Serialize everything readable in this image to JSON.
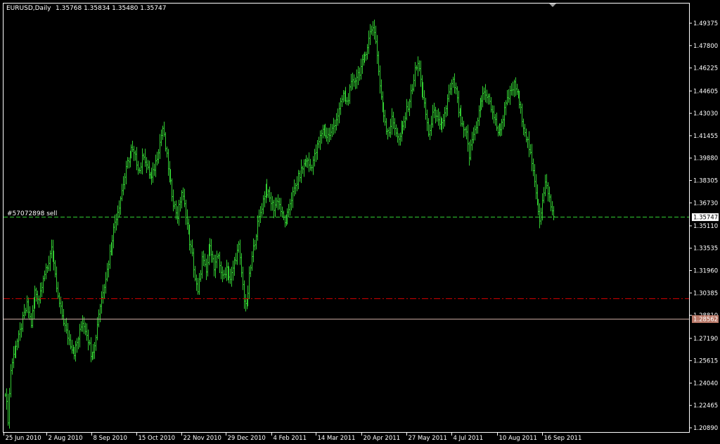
{
  "header": {
    "symbol_label": "EURUSD,Daily",
    "ohlc_values": "1.35768 1.35834 1.35480 1.35747"
  },
  "order_line": {
    "label": "#57072898 sell",
    "price": 1.3574
  },
  "current_price": {
    "text": "1.35747",
    "value": 1.35747
  },
  "level_line": {
    "text": "1.28562",
    "value": 1.28562
  },
  "stop_line": {
    "value": 1.3002
  },
  "colors": {
    "background": "#000000",
    "frame": "#ffffff",
    "bars": "#32cd32",
    "order_line": "#32cd32",
    "stop_line": "#cc0000",
    "level_line": "#c8a8a0",
    "level_tag": "#b87868"
  },
  "chart_data": {
    "type": "ohlc",
    "title": "EURUSD,Daily",
    "ylim": [
      1.2085,
      1.5054
    ],
    "price_ticks": [
      "1.49375",
      "1.47800",
      "1.46225",
      "1.44605",
      "1.43030",
      "1.41455",
      "1.39880",
      "1.38305",
      "1.36730",
      "1.35110",
      "1.33535",
      "1.31960",
      "1.30385",
      "1.28810",
      "1.27190",
      "1.25615",
      "1.24040",
      "1.22465",
      "1.20890"
    ],
    "date_ticks": [
      "25 Jun 2010",
      "2 Aug 2010",
      "8 Sep 2010",
      "15 Oct 2010",
      "22 Nov 2010",
      "29 Dec 2010",
      "4 Feb 2011",
      "14 Mar 2011",
      "20 Apr 2011",
      "27 May 2011",
      "4 Jul 2011",
      "10 Aug 2011",
      "16 Sep 2011"
    ],
    "anchors": [
      [
        0,
        1.235
      ],
      [
        2,
        1.215
      ],
      [
        4,
        1.25
      ],
      [
        7,
        1.265
      ],
      [
        10,
        1.272
      ],
      [
        13,
        1.285
      ],
      [
        16,
        1.295
      ],
      [
        19,
        1.282
      ],
      [
        22,
        1.305
      ],
      [
        25,
        1.3
      ],
      [
        28,
        1.316
      ],
      [
        31,
        1.32
      ],
      [
        34,
        1.338
      ],
      [
        36,
        1.322
      ],
      [
        39,
        1.3
      ],
      [
        42,
        1.288
      ],
      [
        45,
        1.276
      ],
      [
        48,
        1.268
      ],
      [
        51,
        1.262
      ],
      [
        54,
        1.272
      ],
      [
        57,
        1.284
      ],
      [
        60,
        1.276
      ],
      [
        63,
        1.262
      ],
      [
        66,
        1.266
      ],
      [
        69,
        1.29
      ],
      [
        72,
        1.306
      ],
      [
        75,
        1.32
      ],
      [
        78,
        1.338
      ],
      [
        81,
        1.354
      ],
      [
        84,
        1.366
      ],
      [
        87,
        1.381
      ],
      [
        90,
        1.395
      ],
      [
        93,
        1.405
      ],
      [
        96,
        1.399
      ],
      [
        99,
        1.39
      ],
      [
        102,
        1.402
      ],
      [
        105,
        1.39
      ],
      [
        108,
        1.384
      ],
      [
        111,
        1.396
      ],
      [
        114,
        1.41
      ],
      [
        116,
        1.42
      ],
      [
        118,
        1.406
      ],
      [
        121,
        1.386
      ],
      [
        124,
        1.368
      ],
      [
        127,
        1.358
      ],
      [
        130,
        1.375
      ],
      [
        133,
        1.36
      ],
      [
        135,
        1.345
      ],
      [
        138,
        1.33
      ],
      [
        140,
        1.314
      ],
      [
        142,
        1.303
      ],
      [
        145,
        1.328
      ],
      [
        148,
        1.318
      ],
      [
        151,
        1.34
      ],
      [
        154,
        1.32
      ],
      [
        157,
        1.33
      ],
      [
        160,
        1.314
      ],
      [
        163,
        1.322
      ],
      [
        166,
        1.312
      ],
      [
        169,
        1.326
      ],
      [
        172,
        1.336
      ],
      [
        174,
        1.318
      ],
      [
        176,
        1.3
      ],
      [
        178,
        1.294
      ],
      [
        180,
        1.315
      ],
      [
        183,
        1.335
      ],
      [
        186,
        1.352
      ],
      [
        189,
        1.365
      ],
      [
        192,
        1.378
      ],
      [
        195,
        1.37
      ],
      [
        198,
        1.364
      ],
      [
        201,
        1.37
      ],
      [
        204,
        1.358
      ],
      [
        207,
        1.353
      ],
      [
        210,
        1.368
      ],
      [
        213,
        1.376
      ],
      [
        216,
        1.385
      ],
      [
        219,
        1.392
      ],
      [
        222,
        1.398
      ],
      [
        225,
        1.392
      ],
      [
        228,
        1.4
      ],
      [
        231,
        1.41
      ],
      [
        234,
        1.42
      ],
      [
        237,
        1.414
      ],
      [
        240,
        1.416
      ],
      [
        243,
        1.424
      ],
      [
        246,
        1.432
      ],
      [
        249,
        1.444
      ],
      [
        252,
        1.438
      ],
      [
        255,
        1.45
      ],
      [
        258,
        1.455
      ],
      [
        261,
        1.46
      ],
      [
        264,
        1.468
      ],
      [
        267,
        1.478
      ],
      [
        269,
        1.487
      ],
      [
        271,
        1.492
      ],
      [
        273,
        1.482
      ],
      [
        275,
        1.46
      ],
      [
        277,
        1.44
      ],
      [
        279,
        1.43
      ],
      [
        281,
        1.42
      ],
      [
        283,
        1.418
      ],
      [
        285,
        1.426
      ],
      [
        288,
        1.418
      ],
      [
        290,
        1.411
      ],
      [
        293,
        1.42
      ],
      [
        296,
        1.432
      ],
      [
        299,
        1.444
      ],
      [
        302,
        1.46
      ],
      [
        304,
        1.465
      ],
      [
        306,
        1.456
      ],
      [
        308,
        1.44
      ],
      [
        310,
        1.43
      ],
      [
        312,
        1.416
      ],
      [
        314,
        1.422
      ],
      [
        316,
        1.435
      ],
      [
        318,
        1.426
      ],
      [
        321,
        1.418
      ],
      [
        324,
        1.43
      ],
      [
        327,
        1.444
      ],
      [
        330,
        1.452
      ],
      [
        332,
        1.446
      ],
      [
        334,
        1.432
      ],
      [
        337,
        1.42
      ],
      [
        340,
        1.415
      ],
      [
        342,
        1.4
      ],
      [
        344,
        1.412
      ],
      [
        347,
        1.422
      ],
      [
        350,
        1.436
      ],
      [
        353,
        1.446
      ],
      [
        356,
        1.44
      ],
      [
        359,
        1.432
      ],
      [
        362,
        1.42
      ],
      [
        364,
        1.418
      ],
      [
        366,
        1.424
      ],
      [
        369,
        1.436
      ],
      [
        372,
        1.444
      ],
      [
        375,
        1.45
      ],
      [
        377,
        1.446
      ],
      [
        380,
        1.432
      ],
      [
        383,
        1.418
      ],
      [
        386,
        1.406
      ],
      [
        388,
        1.394
      ],
      [
        390,
        1.382
      ],
      [
        392,
        1.37
      ],
      [
        394,
        1.356
      ],
      [
        396,
        1.368
      ],
      [
        398,
        1.38
      ],
      [
        400,
        1.376
      ],
      [
        402,
        1.364
      ],
      [
        404,
        1.358
      ]
    ]
  }
}
